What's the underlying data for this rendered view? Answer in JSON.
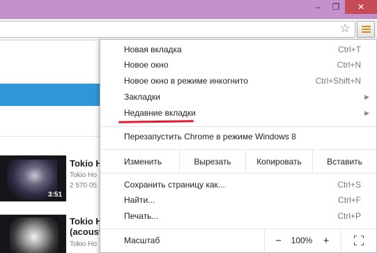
{
  "window": {
    "minimize_glyph": "–",
    "maximize_glyph": "❐",
    "close_glyph": "✕"
  },
  "toolbar": {
    "star_glyph": "☆",
    "menu_icon": "hamburger-icon",
    "menu_icon_color": "#e08a1c"
  },
  "page": {
    "videos": [
      {
        "title": "Tokio H",
        "meta1": "Tokio Ho",
        "meta2": "2 570 05",
        "duration": "3:51"
      },
      {
        "title": "Tokio H",
        "title2": "(acoust",
        "meta1": "Tokio Ho"
      }
    ]
  },
  "menu": {
    "items": [
      {
        "label": "Новая вкладка",
        "shortcut": "Ctrl+T"
      },
      {
        "label": "Новое окно",
        "shortcut": "Ctrl+N"
      },
      {
        "label": "Новое окно в режиме инкогнито",
        "shortcut": "Ctrl+Shift+N"
      },
      {
        "label": "Закладки",
        "submenu": "▶"
      },
      {
        "label": "Недавние вкладки",
        "submenu": "▶"
      }
    ],
    "relaunch": "Перезапустить Chrome в режиме Windows 8",
    "edit": {
      "label": "Изменить",
      "cut": "Вырезать",
      "copy": "Копировать",
      "paste": "Вставить"
    },
    "items2": [
      {
        "label": "Сохранить страницу как...",
        "shortcut": "Ctrl+S"
      },
      {
        "label": "Найти...",
        "shortcut": "Ctrl+F"
      },
      {
        "label": "Печать...",
        "shortcut": "Ctrl+P"
      }
    ],
    "zoom": {
      "label": "Масштаб",
      "minus": "−",
      "value": "100%",
      "plus": "+"
    },
    "highlight_color": "#e31a2d"
  }
}
